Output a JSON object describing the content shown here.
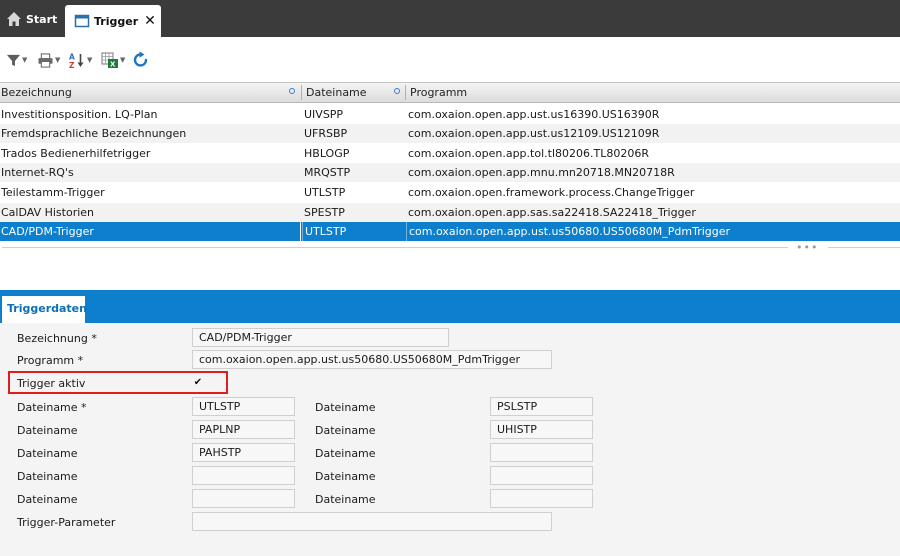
{
  "tabs": {
    "start_label": "Start",
    "active_label": "Trigger"
  },
  "toolbar": {
    "icons": [
      "filter-icon",
      "print-icon",
      "sort-az-icon",
      "excel-export-icon",
      "refresh-icon"
    ]
  },
  "table": {
    "columns": [
      "Bezeichnung",
      "Dateiname",
      "Programm"
    ],
    "rows": [
      [
        "Investitionsposition. LQ-Plan",
        "UIVSPP",
        "com.oxaion.open.app.ust.us16390.US16390R"
      ],
      [
        "Fremdsprachliche Bezeichnungen",
        "UFRSBP",
        "com.oxaion.open.app.ust.us12109.US12109R"
      ],
      [
        "Trados Bedienerhilfetrigger",
        "HBLOGP",
        "com.oxaion.open.app.tol.tl80206.TL80206R"
      ],
      [
        "Internet-RQ's",
        "MRQSTP",
        "com.oxaion.open.app.mnu.mn20718.MN20718R"
      ],
      [
        "Teilestamm-Trigger",
        "UTLSTP",
        "com.oxaion.open.framework.process.ChangeTrigger"
      ],
      [
        "CalDAV Historien",
        "SPESTP",
        "com.oxaion.open.app.sas.sa22418.SA22418_Trigger"
      ],
      [
        "CAD/PDM-Trigger",
        "UTLSTP",
        "com.oxaion.open.app.ust.us50680.US50680M_PdmTrigger"
      ]
    ],
    "selected_index": 6
  },
  "details": {
    "tab_label": "Triggerdaten",
    "bezeichnung_label": "Bezeichnung *",
    "bezeichnung_value": "CAD/PDM-Trigger",
    "programm_label": "Programm *",
    "programm_value": "com.oxaion.open.app.ust.us50680.US50680M_PdmTrigger",
    "trigger_aktiv_label": "Trigger aktiv",
    "trigger_aktiv_checked": true,
    "trigger_aktiv_mark": "✔",
    "left_dateinamen": [
      {
        "label": "Dateiname *",
        "value": "UTLSTP"
      },
      {
        "label": "Dateiname",
        "value": "PAPLNP"
      },
      {
        "label": "Dateiname",
        "value": "PAHSTP"
      },
      {
        "label": "Dateiname",
        "value": ""
      },
      {
        "label": "Dateiname",
        "value": ""
      }
    ],
    "right_dateinamen": [
      {
        "label": "Dateiname",
        "value": "PSLSTP"
      },
      {
        "label": "Dateiname",
        "value": "UHISTP"
      },
      {
        "label": "Dateiname",
        "value": ""
      },
      {
        "label": "Dateiname",
        "value": ""
      },
      {
        "label": "Dateiname",
        "value": ""
      }
    ],
    "trigger_parameter_label": "Trigger-Parameter",
    "trigger_parameter_value": ""
  },
  "colors": {
    "accent": "#0d7fcc",
    "tabbar": "#3b3b3b",
    "highlight": "#e01e1e"
  }
}
